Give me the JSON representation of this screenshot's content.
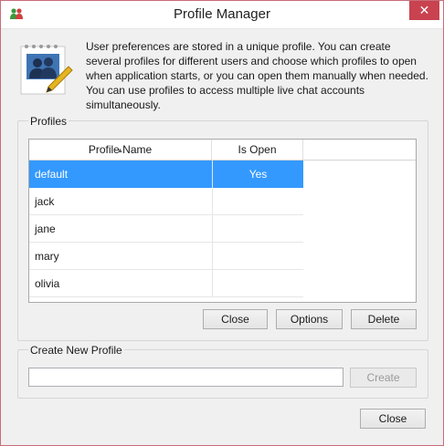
{
  "window": {
    "title": "Profile Manager",
    "close_glyph": "✕"
  },
  "info": {
    "icon": "users-edit-icon",
    "text": "User preferences are stored in a unique profile. You can create several profiles for different users and choose which profiles to open when application starts, or you can open them manually when needed. You can use profiles to access multiple live chat accounts simultaneously."
  },
  "profiles_group": {
    "label": "Profiles",
    "columns": [
      "Profile Name",
      "Is Open"
    ],
    "rows": [
      {
        "name": "default",
        "is_open": "Yes",
        "selected": true
      },
      {
        "name": "jack",
        "is_open": "",
        "selected": false
      },
      {
        "name": "jane",
        "is_open": "",
        "selected": false
      },
      {
        "name": "mary",
        "is_open": "",
        "selected": false
      },
      {
        "name": "olivia",
        "is_open": "",
        "selected": false
      }
    ],
    "buttons": {
      "close": "Close",
      "options": "Options",
      "delete": "Delete"
    }
  },
  "create_group": {
    "label": "Create New Profile",
    "input_value": "",
    "create_button": "Create"
  },
  "footer": {
    "close_button": "Close"
  },
  "colors": {
    "selection": "#3399ff",
    "close_button_bg": "#c8434f"
  }
}
